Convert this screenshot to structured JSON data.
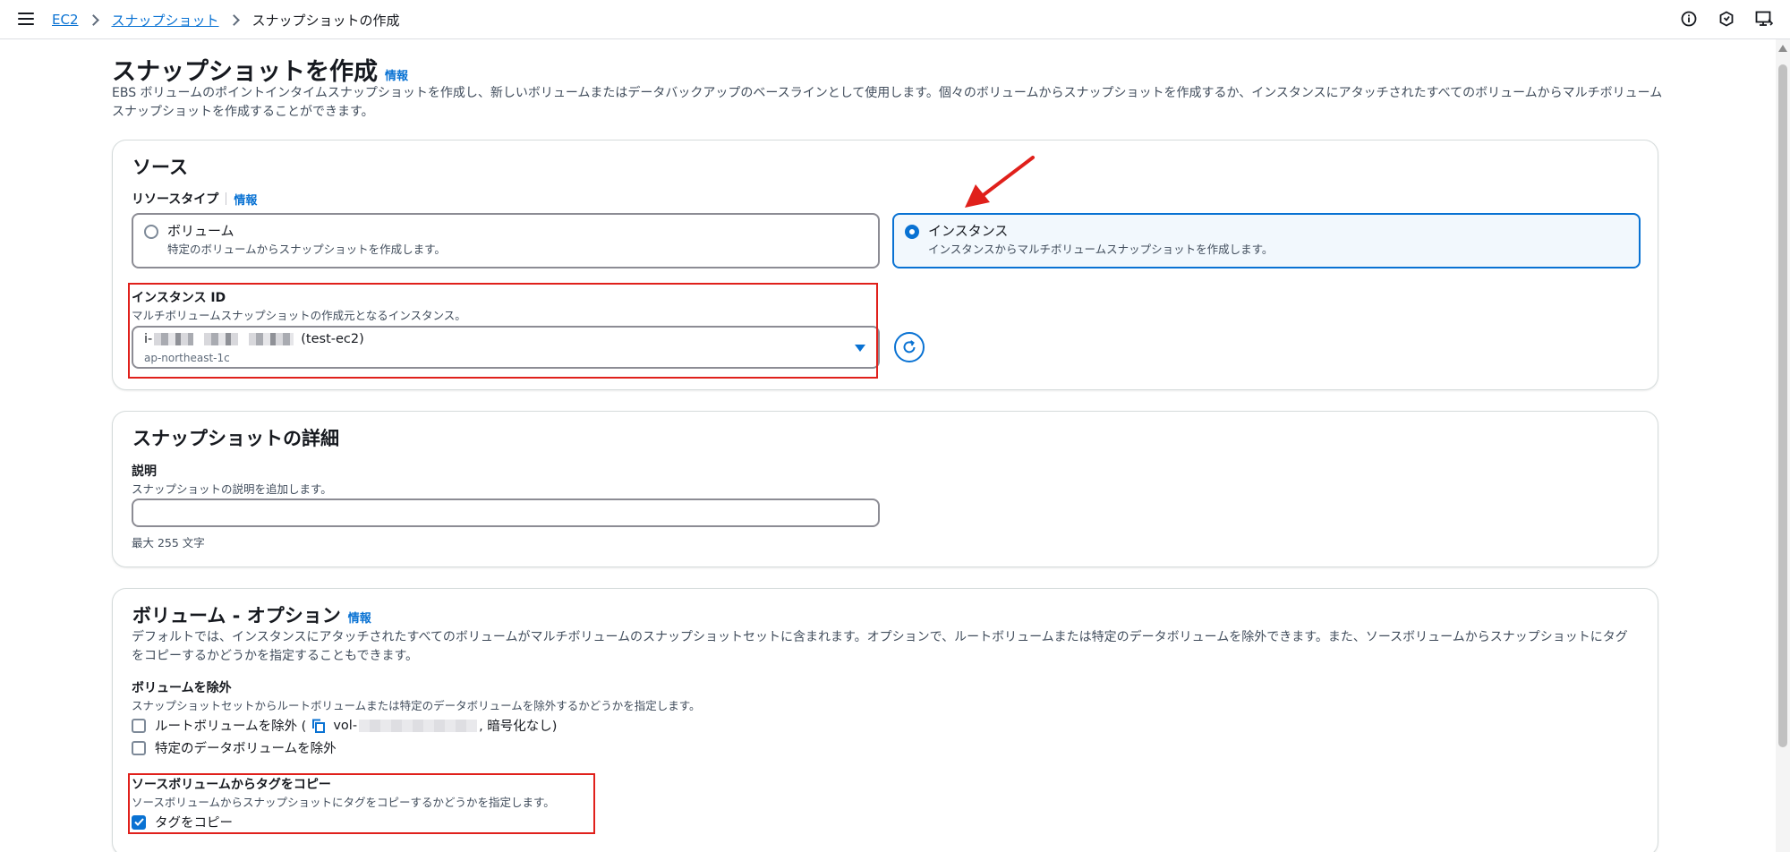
{
  "breadcrumb": {
    "items": [
      "EC2",
      "スナップショット"
    ],
    "current": "スナップショットの作成"
  },
  "page": {
    "title": "スナップショットを作成",
    "info": "情報",
    "description": "EBS ボリュームのポイントインタイムスナップショットを作成し、新しいボリュームまたはデータバックアップのベースラインとして使用します。個々のボリュームからスナップショットを作成するか、インスタンスにアタッチされたすべてのボリュームからマルチボリュームスナップショットを作成することができます。"
  },
  "source": {
    "title": "ソース",
    "resource_type_label": "リソースタイプ",
    "resource_type_info": "情報",
    "options": [
      {
        "title": "ボリューム",
        "desc": "特定のボリュームからスナップショットを作成します。",
        "selected": false
      },
      {
        "title": "インスタンス",
        "desc": "インスタンスからマルチボリュームスナップショットを作成します。",
        "selected": true
      }
    ],
    "instance_id_label": "インスタンス ID",
    "instance_id_desc": "マルチボリュームスナップショットの作成元となるインスタンス。",
    "instance_prefix": "i-",
    "instance_name": "(test-ec2)",
    "instance_az": "ap-northeast-1c"
  },
  "details": {
    "title": "スナップショットの詳細",
    "description_label": "説明",
    "description_hint": "スナップショットの説明を追加します。",
    "description_value": "",
    "constraint": "最大 255 文字"
  },
  "volume_options": {
    "title": "ボリューム - オプション",
    "info": "情報",
    "description": "デフォルトでは、インスタンスにアタッチされたすべてのボリュームがマルチボリュームのスナップショットセットに含まれます。オプションで、ルートボリュームまたは特定のデータボリュームを除外できます。また、ソースボリュームからスナップショットにタグをコピーするかどうかを指定することもできます。",
    "exclude_label": "ボリュームを除外",
    "exclude_desc": "スナップショットセットからルートボリュームまたは特定のデータボリュームを除外するかどうかを指定します。",
    "exclude_root_prefix": "ルートボリュームを除外 (",
    "exclude_root_vol": "vol-",
    "exclude_root_suffix": ", 暗号化なし)",
    "exclude_data": "特定のデータボリュームを除外",
    "copy_tags_label": "ソースボリュームからタグをコピー",
    "copy_tags_desc": "ソースボリュームからスナップショットにタグをコピーするかどうかを指定します。",
    "copy_tags_checkbox": "タグをコピー",
    "copy_tags_checked": true
  },
  "colors": {
    "accent": "#0972d3",
    "highlight": "#e0201b"
  },
  "icons": [
    "menu-icon",
    "info-circle-icon",
    "settings-hex-icon",
    "feedback-icon",
    "refresh-icon",
    "copy-icon",
    "check-icon",
    "annotation-arrow"
  ]
}
